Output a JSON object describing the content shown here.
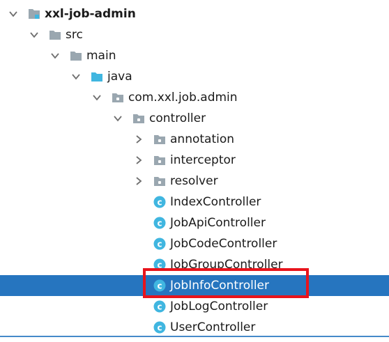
{
  "tree": {
    "rows": [
      {
        "label": "xxl-job-admin",
        "depth": 0,
        "expanded": true,
        "icon": "module-folder-icon",
        "bold": true
      },
      {
        "label": "src",
        "depth": 1,
        "expanded": true,
        "icon": "folder-icon"
      },
      {
        "label": "main",
        "depth": 2,
        "expanded": true,
        "icon": "folder-icon"
      },
      {
        "label": "java",
        "depth": 3,
        "expanded": true,
        "icon": "source-root-folder-icon"
      },
      {
        "label": "com.xxl.job.admin",
        "depth": 4,
        "expanded": true,
        "icon": "package-icon"
      },
      {
        "label": "controller",
        "depth": 5,
        "expanded": true,
        "icon": "package-icon"
      },
      {
        "label": "annotation",
        "depth": 6,
        "expanded": false,
        "icon": "package-icon"
      },
      {
        "label": "interceptor",
        "depth": 6,
        "expanded": false,
        "icon": "package-icon"
      },
      {
        "label": "resolver",
        "depth": 6,
        "expanded": false,
        "icon": "package-icon"
      },
      {
        "label": "IndexController",
        "depth": 6,
        "leaf": true,
        "icon": "class-icon"
      },
      {
        "label": "JobApiController",
        "depth": 6,
        "leaf": true,
        "icon": "class-icon"
      },
      {
        "label": "JobCodeController",
        "depth": 6,
        "leaf": true,
        "icon": "class-icon"
      },
      {
        "label": "JobGroupController",
        "depth": 6,
        "leaf": true,
        "icon": "class-icon"
      },
      {
        "label": "JobInfoController",
        "depth": 6,
        "leaf": true,
        "icon": "class-icon",
        "selected": true
      },
      {
        "label": "JobLogController",
        "depth": 6,
        "leaf": true,
        "icon": "class-icon"
      },
      {
        "label": "UserController",
        "depth": 6,
        "leaf": true,
        "icon": "class-icon"
      }
    ]
  },
  "colors": {
    "selection": "#2675bf",
    "highlight_border": "#e8141c",
    "folder": "#9aa7b0",
    "source_folder": "#40b6e0",
    "class_icon": "#40b6e0"
  },
  "class_icon_letter": "c"
}
